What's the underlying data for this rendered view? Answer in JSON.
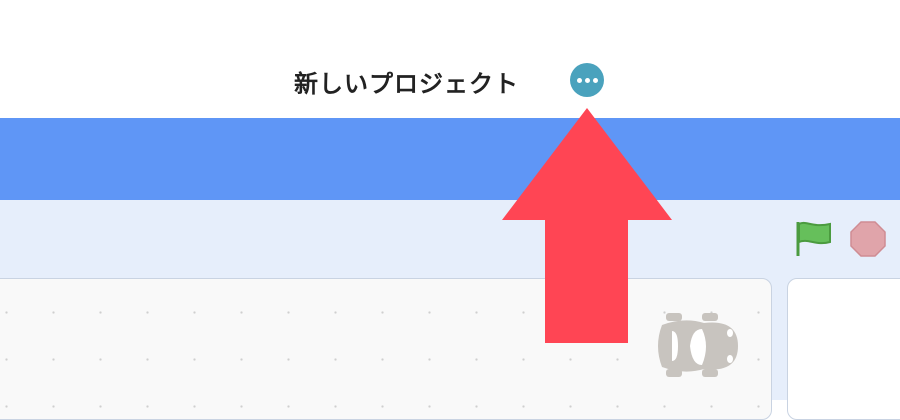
{
  "header": {
    "title": "新しいプロジェクト",
    "more_button": "more-icon"
  },
  "colors": {
    "menu_bar": "#5f96f6",
    "toolbar": "#e6eefb",
    "annotation_arrow": "#ff4554",
    "more_button": "#4aa2bd"
  },
  "toolbar": {
    "go_icon": "green-flag-icon",
    "stop_icon": "stop-icon"
  },
  "sprite": {
    "icon": "car-icon"
  }
}
